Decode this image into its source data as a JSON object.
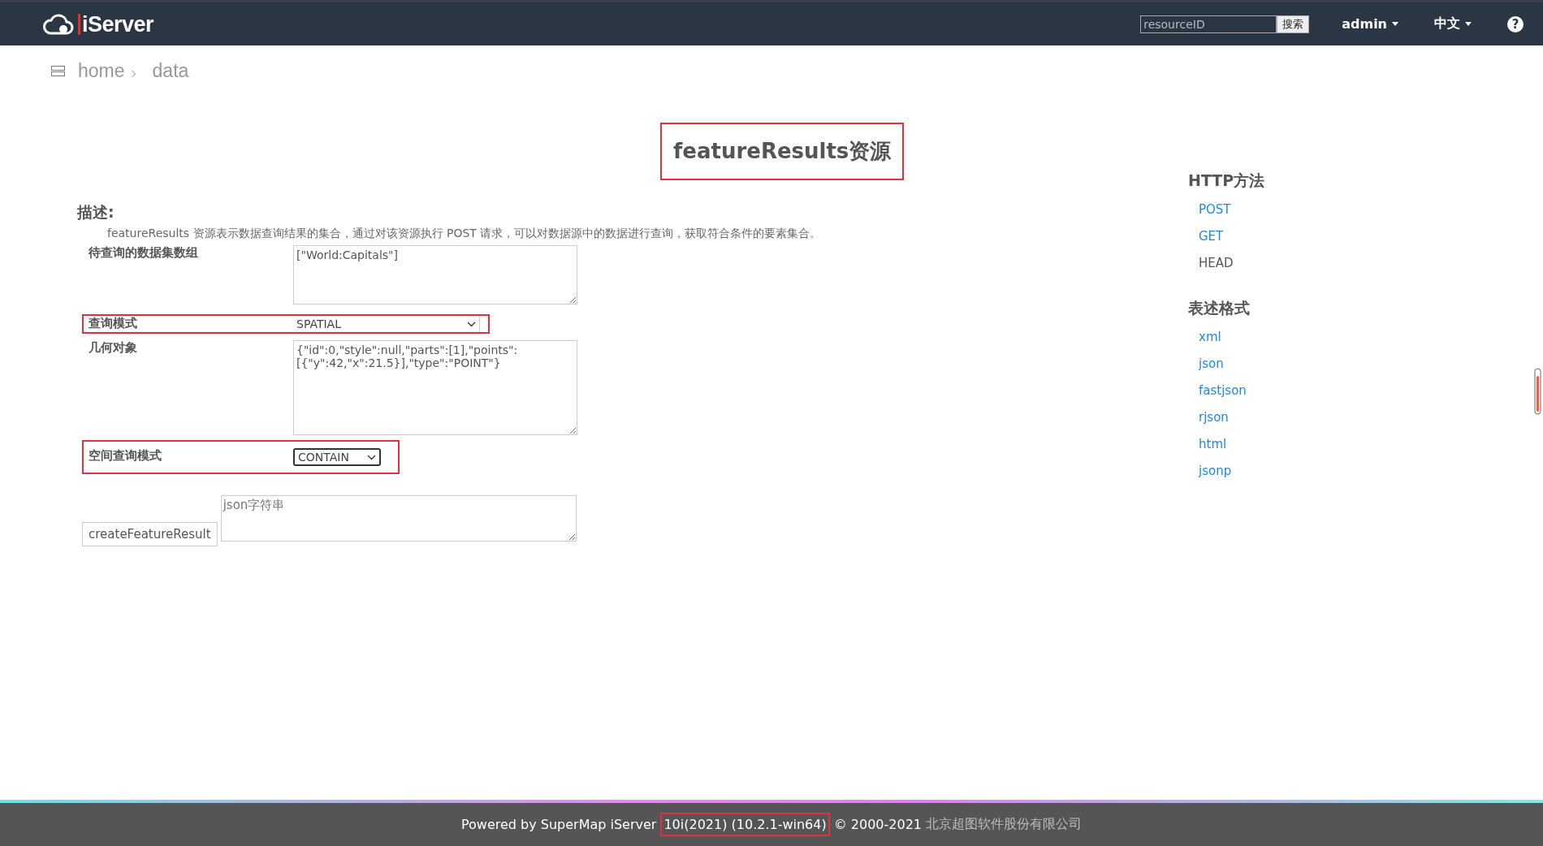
{
  "header": {
    "logo": "iServer",
    "search": {
      "placeholder": "resourceID",
      "button": "搜索"
    },
    "user_menu": "admin",
    "language_menu": "中文",
    "help": "?"
  },
  "breadcrumb": [
    "home",
    "data"
  ],
  "title": {
    "text": "featureResults资源",
    "highlighted": true
  },
  "description": {
    "heading": "描述:",
    "text": "featureResults 资源表示数据查询结果的集合，通过对该资源执行 POST 请求，可以对数据源中的数据进行查询，获取符合条件的要素集合。"
  },
  "form_rows": [
    {
      "kind": "textarea",
      "label": "待查询的数据集数组",
      "value": "[\"World:Capitals\"]",
      "highlighted": false
    },
    {
      "kind": "select",
      "label": "查询模式",
      "value": "SPATIAL",
      "highlighted": true
    },
    {
      "kind": "textarea",
      "label": "几何对象",
      "value": "{\"id\":0,\"style\":null,\"parts\":[1],\"points\":[{\"y\":42,\"x\":21.5}],\"type\":\"POINT\"}",
      "highlighted": false
    },
    {
      "kind": "small-select",
      "label": "空间查询模式",
      "value": "CONTAIN",
      "highlighted": true
    }
  ],
  "submit": {
    "button": "createFeatureResult",
    "placeholder": "json字符串"
  },
  "sidebar": [
    {
      "heading": "HTTP方法",
      "items": [
        {
          "label": "POST",
          "link": true
        },
        {
          "label": "GET",
          "link": true
        },
        {
          "label": "HEAD",
          "link": false
        }
      ]
    },
    {
      "heading": "表述格式",
      "items": [
        {
          "label": "xml",
          "link": true
        },
        {
          "label": "json",
          "link": true
        },
        {
          "label": "fastjson",
          "link": true
        },
        {
          "label": "rjson",
          "link": true
        },
        {
          "label": "html",
          "link": true
        },
        {
          "label": "jsonp",
          "link": true
        }
      ]
    }
  ],
  "footer": {
    "prefix": "Powered by SuperMap iServer",
    "version": {
      "text": "10i(2021) (10.2.1-win64)",
      "highlighted": true
    },
    "copyright": "© 2000-2021",
    "company": "北京超图软件股份有限公司"
  }
}
